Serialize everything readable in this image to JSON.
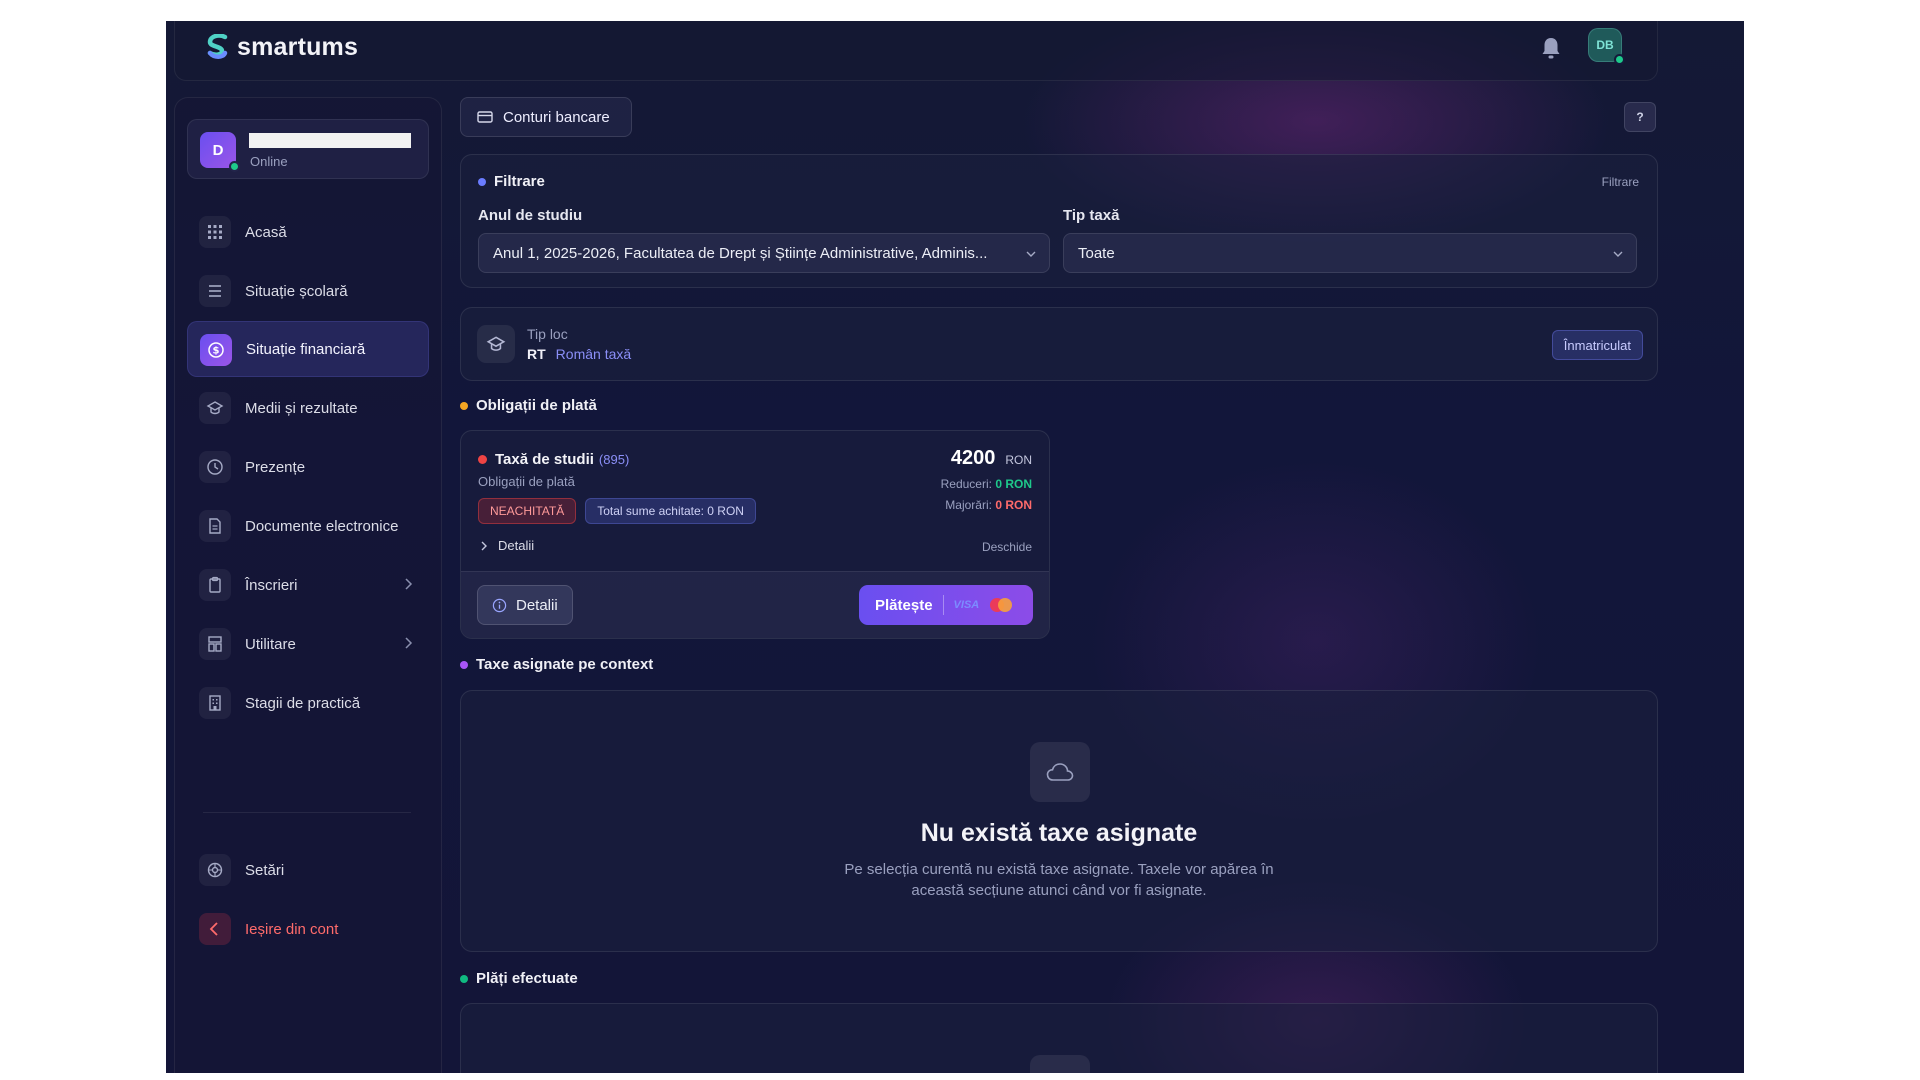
{
  "app": {
    "brand": "smartums",
    "user_initials": "DB"
  },
  "sidebar": {
    "user": {
      "initial": "D",
      "status": "Online"
    },
    "items": [
      {
        "label": "Acasă",
        "icon": "grid-icon"
      },
      {
        "label": "Situație școlară",
        "icon": "list-icon"
      },
      {
        "label": "Situație financiară",
        "icon": "dollar-icon"
      },
      {
        "label": "Medii și rezultate",
        "icon": "graduation-cap-icon"
      },
      {
        "label": "Prezențe",
        "icon": "clock-icon"
      },
      {
        "label": "Documente electronice",
        "icon": "document-icon"
      },
      {
        "label": "Înscrieri",
        "icon": "clipboard-icon"
      },
      {
        "label": "Utilitare",
        "icon": "layout-icon"
      },
      {
        "label": "Stagii de practică",
        "icon": "building-icon"
      },
      {
        "label": "Setări",
        "icon": "settings-icon"
      },
      {
        "label": "Ieșire din cont",
        "icon": "chevron-left-icon"
      }
    ]
  },
  "main": {
    "top_button": "Conturi bancare",
    "help": "?",
    "filter": {
      "title": "Filtrare",
      "right_label": "Filtrare",
      "year_label": "Anul de studiu",
      "year_value": "Anul 1, 2025-2026, Facultatea de Drept și Științe Administrative, Adminis...",
      "fee_label": "Tip taxă",
      "fee_value": "Toate"
    },
    "place": {
      "label": "Tip loc",
      "code": "RT",
      "value": "Român taxă",
      "badge": "Înmatriculat"
    },
    "obligations": {
      "title": "Obligații de plată",
      "card": {
        "name": "Taxă de studii",
        "code": "(895)",
        "subtitle": "Obligații de plată",
        "amount": "4200",
        "currency": "RON",
        "discount_label": "Reduceri:",
        "discount_value": "0 RON",
        "penalty_label": "Majorări:",
        "penalty_value": "0 RON",
        "status": "NEACHITATĂ",
        "paid_total": "Total sume achitate: 0 RON",
        "details_toggle": "Detalii",
        "open_link": "Deschide",
        "details_button": "Detalii",
        "pay_button": "Plătește",
        "visa": "VISA"
      }
    },
    "assigned": {
      "title": "Taxe asignate pe context",
      "empty_title": "Nu există taxe asignate",
      "empty_line1": "Pe selecția curentă nu există taxe asignate. Taxele vor apărea în",
      "empty_line2": "această secțiune atunci când vor fi asignate."
    },
    "payments": {
      "title": "Plăți efectuate"
    }
  },
  "colors": {
    "accent": "#6a4ff0",
    "online": "#1ec98b",
    "danger": "#ef4444",
    "warning": "#f5a623",
    "purple_dot": "#a855f7",
    "green_dot": "#10b981",
    "link": "#8b8ff7"
  }
}
